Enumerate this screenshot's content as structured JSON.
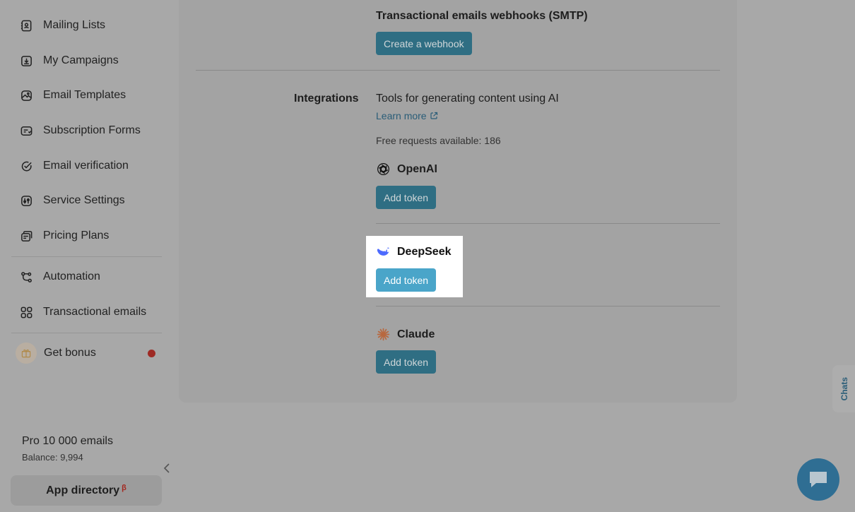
{
  "sidebar": {
    "items": [
      {
        "label": "Mailing Lists",
        "icon": "contacts-icon"
      },
      {
        "label": "My Campaigns",
        "icon": "campaign-icon"
      },
      {
        "label": "Email Templates",
        "icon": "templates-icon"
      },
      {
        "label": "Subscription Forms",
        "icon": "forms-icon"
      },
      {
        "label": "Email verification",
        "icon": "check-circle-icon"
      },
      {
        "label": "Service Settings",
        "icon": "settings-icon"
      },
      {
        "label": "Pricing Plans",
        "icon": "pricing-icon"
      },
      {
        "label": "Automation",
        "icon": "automation-icon"
      },
      {
        "label": "Transactional emails",
        "icon": "grid-icon"
      },
      {
        "label": "Get bonus",
        "icon": "gift-icon"
      }
    ],
    "plan": {
      "name": "Pro 10 000 emails",
      "balance": "Balance: 9,994"
    },
    "app_directory": {
      "label": "App directory",
      "badge": "β"
    }
  },
  "main": {
    "smtp_title": "Transactional emails webhooks (SMTP)",
    "create_webhook": "Create a webhook",
    "integrations_label": "Integrations",
    "integrations_desc": "Tools for generating content using AI",
    "learn_more": "Learn more",
    "free_requests": "Free requests available: 186",
    "providers": [
      {
        "name": "OpenAI",
        "button": "Add token"
      },
      {
        "name": "DeepSeek",
        "button": "Add token"
      },
      {
        "name": "Claude",
        "button": "Add token"
      }
    ]
  },
  "chats_tab": "Chats",
  "colors": {
    "accent": "#2f6e83",
    "highlight_button": "#4aa5c9",
    "notification_dot": "#9e2a24",
    "deepseek_blue": "#4d6bfe",
    "claude_orange": "#d97757"
  }
}
